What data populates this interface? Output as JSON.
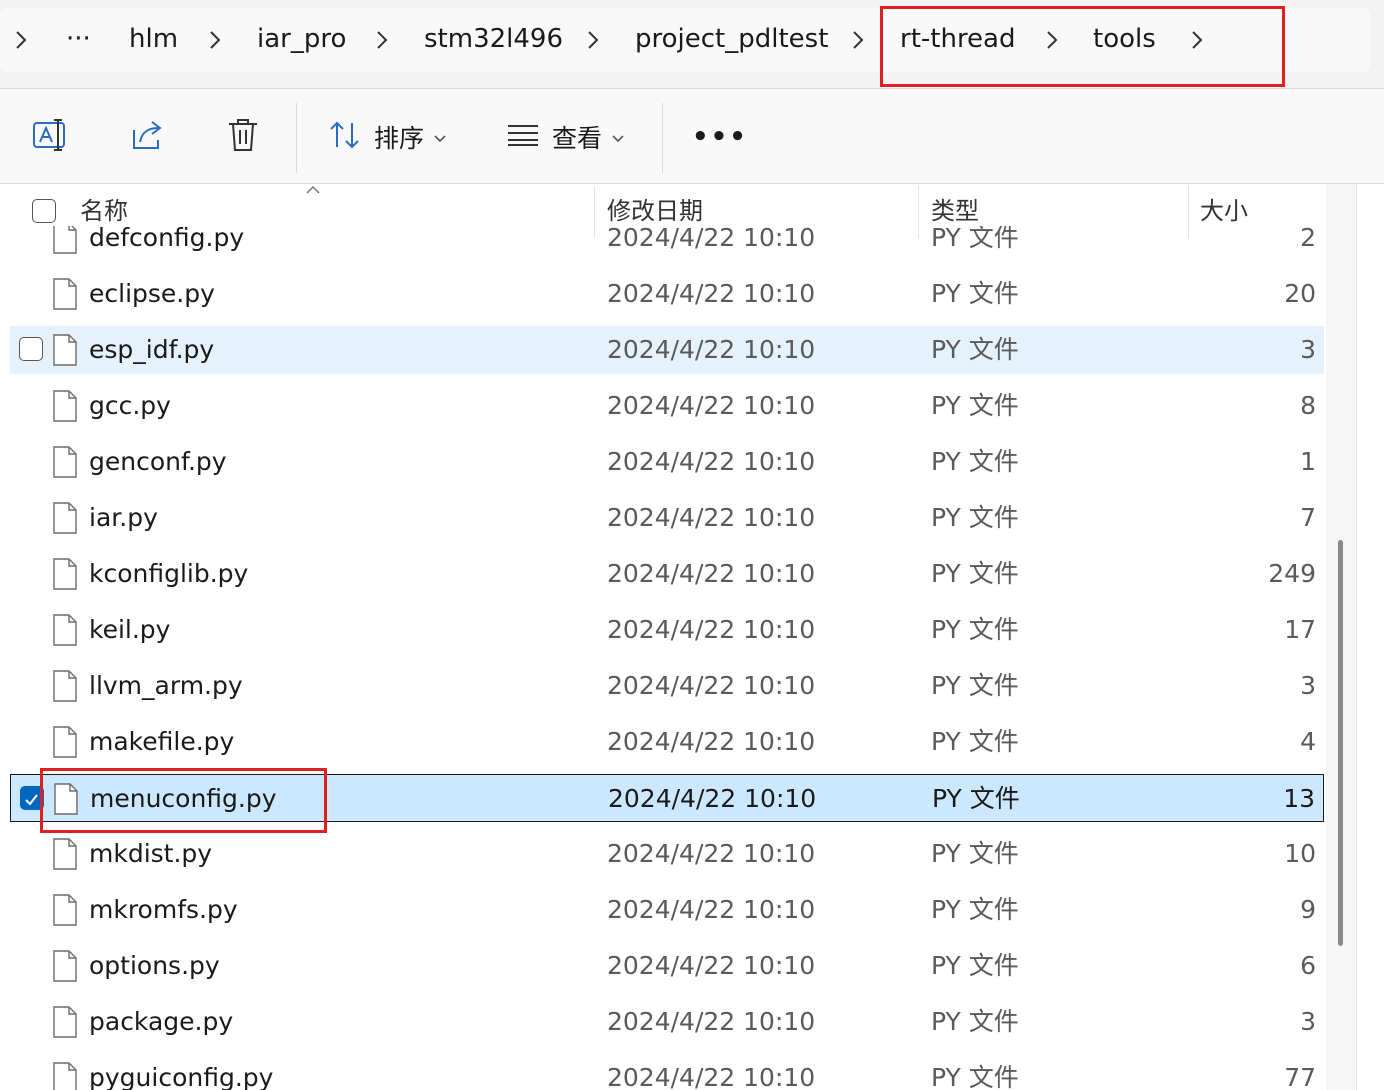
{
  "breadcrumb": {
    "more": "···",
    "items": [
      "hlm",
      "iar_pro",
      "stm32l496",
      "project_pdltest",
      "rt-thread",
      "tools"
    ]
  },
  "toolbar": {
    "sort_label": "排序",
    "view_label": "查看",
    "more": "•••"
  },
  "columns": {
    "name": "名称",
    "date": "修改日期",
    "type": "类型",
    "size": "大小"
  },
  "rows": [
    {
      "name": "defconfig.py",
      "date": "2024/4/22 10:10",
      "type": "PY 文件",
      "size": "2"
    },
    {
      "name": "eclipse.py",
      "date": "2024/4/22 10:10",
      "type": "PY 文件",
      "size": "20"
    },
    {
      "name": "esp_idf.py",
      "date": "2024/4/22 10:10",
      "type": "PY 文件",
      "size": "3"
    },
    {
      "name": "gcc.py",
      "date": "2024/4/22 10:10",
      "type": "PY 文件",
      "size": "8"
    },
    {
      "name": "genconf.py",
      "date": "2024/4/22 10:10",
      "type": "PY 文件",
      "size": "1"
    },
    {
      "name": "iar.py",
      "date": "2024/4/22 10:10",
      "type": "PY 文件",
      "size": "7"
    },
    {
      "name": "kconfiglib.py",
      "date": "2024/4/22 10:10",
      "type": "PY 文件",
      "size": "249"
    },
    {
      "name": "keil.py",
      "date": "2024/4/22 10:10",
      "type": "PY 文件",
      "size": "17"
    },
    {
      "name": "llvm_arm.py",
      "date": "2024/4/22 10:10",
      "type": "PY 文件",
      "size": "3"
    },
    {
      "name": "makefile.py",
      "date": "2024/4/22 10:10",
      "type": "PY 文件",
      "size": "4"
    },
    {
      "name": "menuconfig.py",
      "date": "2024/4/22 10:10",
      "type": "PY 文件",
      "size": "13"
    },
    {
      "name": "mkdist.py",
      "date": "2024/4/22 10:10",
      "type": "PY 文件",
      "size": "10"
    },
    {
      "name": "mkromfs.py",
      "date": "2024/4/22 10:10",
      "type": "PY 文件",
      "size": "9"
    },
    {
      "name": "options.py",
      "date": "2024/4/22 10:10",
      "type": "PY 文件",
      "size": "6"
    },
    {
      "name": "package.py",
      "date": "2024/4/22 10:10",
      "type": "PY 文件",
      "size": "3"
    },
    {
      "name": "pyguiconfig.py",
      "date": "2024/4/22 10:10",
      "type": "PY 文件",
      "size": "77"
    }
  ],
  "hover_index": 2,
  "selected_index": 10
}
